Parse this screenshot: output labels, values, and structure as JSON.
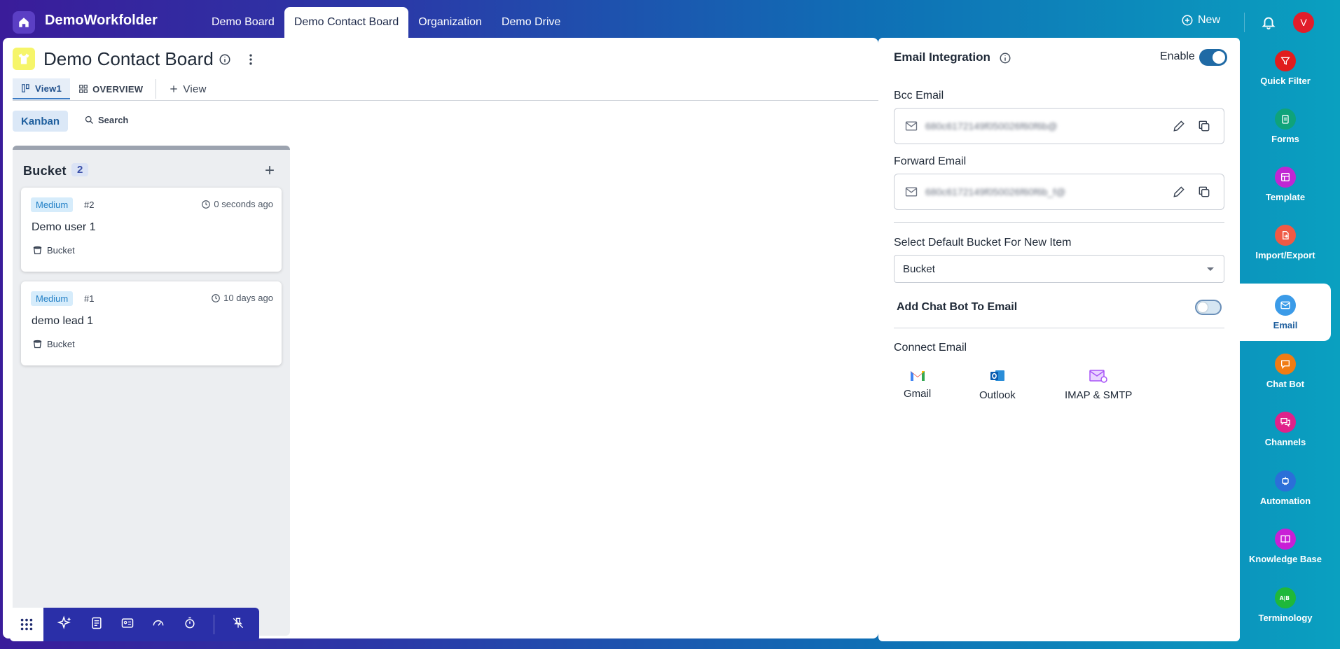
{
  "app": {
    "brand": "DemoWorkfolder",
    "tabs": [
      "Demo Board",
      "Demo Contact Board",
      "Organization",
      "Demo Drive"
    ],
    "new_label": "New",
    "avatar_initial": "V"
  },
  "board": {
    "title": "Demo Contact Board",
    "views": {
      "view1": "View1",
      "overview": "OVERVIEW",
      "add_view": "View"
    },
    "kanban_label": "Kanban",
    "search_label": "Search"
  },
  "column": {
    "title": "Bucket",
    "count": "2",
    "cards": [
      {
        "priority": "Medium",
        "number": "#2",
        "time": "0 seconds ago",
        "name": "Demo user 1",
        "bucket": "Bucket"
      },
      {
        "priority": "Medium",
        "number": "#1",
        "time": "10 days ago",
        "name": "demo lead 1",
        "bucket": "Bucket"
      }
    ]
  },
  "email_panel": {
    "title": "Email Integration",
    "enable_label": "Enable",
    "enabled": true,
    "bcc_label": "Bcc Email",
    "bcc_value": "680c6172149f050026f60f6b@",
    "forward_label": "Forward Email",
    "forward_value": "680c6172149f050026f60f6b_f@",
    "default_bucket_label": "Select Default Bucket For New Item",
    "default_bucket_value": "Bucket",
    "chatbot_label": "Add Chat Bot To Email",
    "chatbot_enabled": false,
    "connect_title": "Connect Email",
    "providers": [
      "Gmail",
      "Outlook",
      "IMAP & SMTP"
    ]
  },
  "right_nav": [
    {
      "label": "Quick Filter",
      "icon": "filter-icon",
      "color": "#e11d1d"
    },
    {
      "label": "Forms",
      "icon": "clipboard-icon",
      "color": "#0fa37a"
    },
    {
      "label": "Template",
      "icon": "template-icon",
      "color": "#c026d3"
    },
    {
      "label": "Import/Export",
      "icon": "import-export-icon",
      "color": "#ef5a45"
    },
    {
      "label": "Email",
      "icon": "mail-icon",
      "color": "#3b9be8",
      "active": true
    },
    {
      "label": "Chat Bot",
      "icon": "chat-icon",
      "color": "#f07c12"
    },
    {
      "label": "Channels",
      "icon": "channels-icon",
      "color": "#e0218a"
    },
    {
      "label": "Automation",
      "icon": "robot-icon",
      "color": "#2b6fd8"
    },
    {
      "label": "Knowledge Base",
      "icon": "book-icon",
      "color": "#c91fd6"
    },
    {
      "label": "Terminology",
      "icon": "ab-icon",
      "color": "#1fb83a"
    }
  ]
}
